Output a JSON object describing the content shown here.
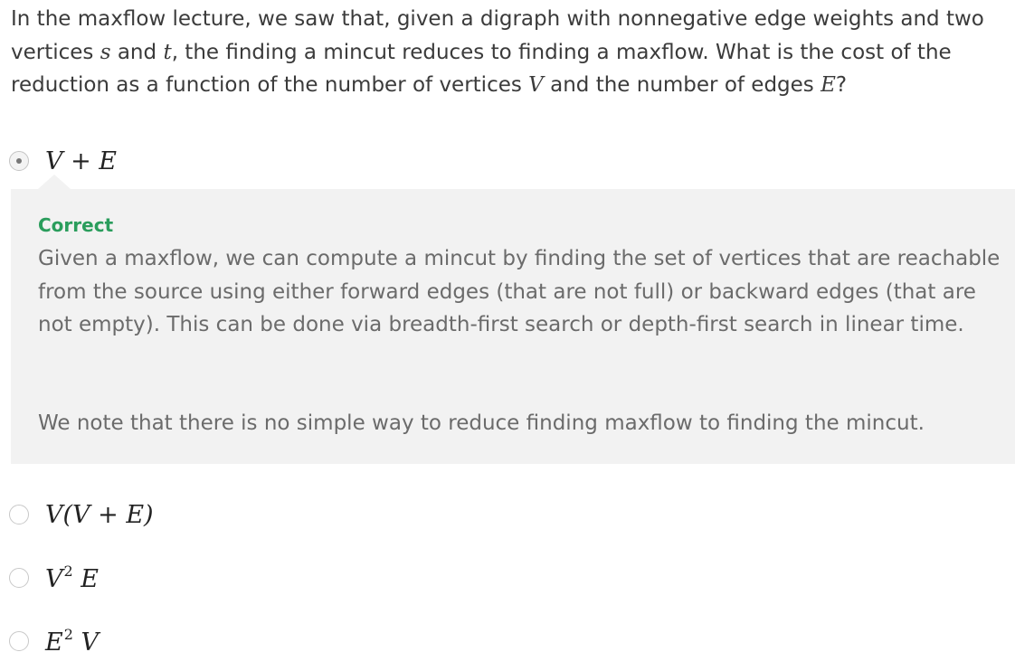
{
  "question": {
    "text_1": "In the maxflow lecture, we saw that, given a digraph with nonnegative edge weights and two vertices ",
    "var_s": "s",
    "text_2": " and ",
    "var_t": "t",
    "text_3": ", the finding a mincut reduces to finding a maxflow. What is the cost of the reduction as a function of the number of vertices ",
    "var_v": "V",
    "text_4": " and the number of edges ",
    "var_e": "E",
    "text_5": "?"
  },
  "options": [
    {
      "label": "V + E",
      "selected": true
    },
    {
      "label": "V(V + E)",
      "selected": false
    },
    {
      "base_1": "V",
      "sup_1": "2",
      "base_2": "E",
      "selected": false
    },
    {
      "base_1": "E",
      "sup_1": "2",
      "base_2": "V",
      "selected": false
    }
  ],
  "feedback": {
    "status": "Correct",
    "explanation": "Given a maxflow, we can compute a mincut by finding the set of vertices that are reachable from the source using either forward edges (that are not full) or backward edges (that are not empty). This can be done via breadth-first search or depth-first search in linear time.",
    "note": "We note that there is no simple way to reduce finding maxflow to finding the mincut."
  },
  "colors": {
    "correct_green": "#2a9d5c",
    "feedback_background": "#f2f2f2",
    "feedback_text": "#6b6b6b"
  }
}
